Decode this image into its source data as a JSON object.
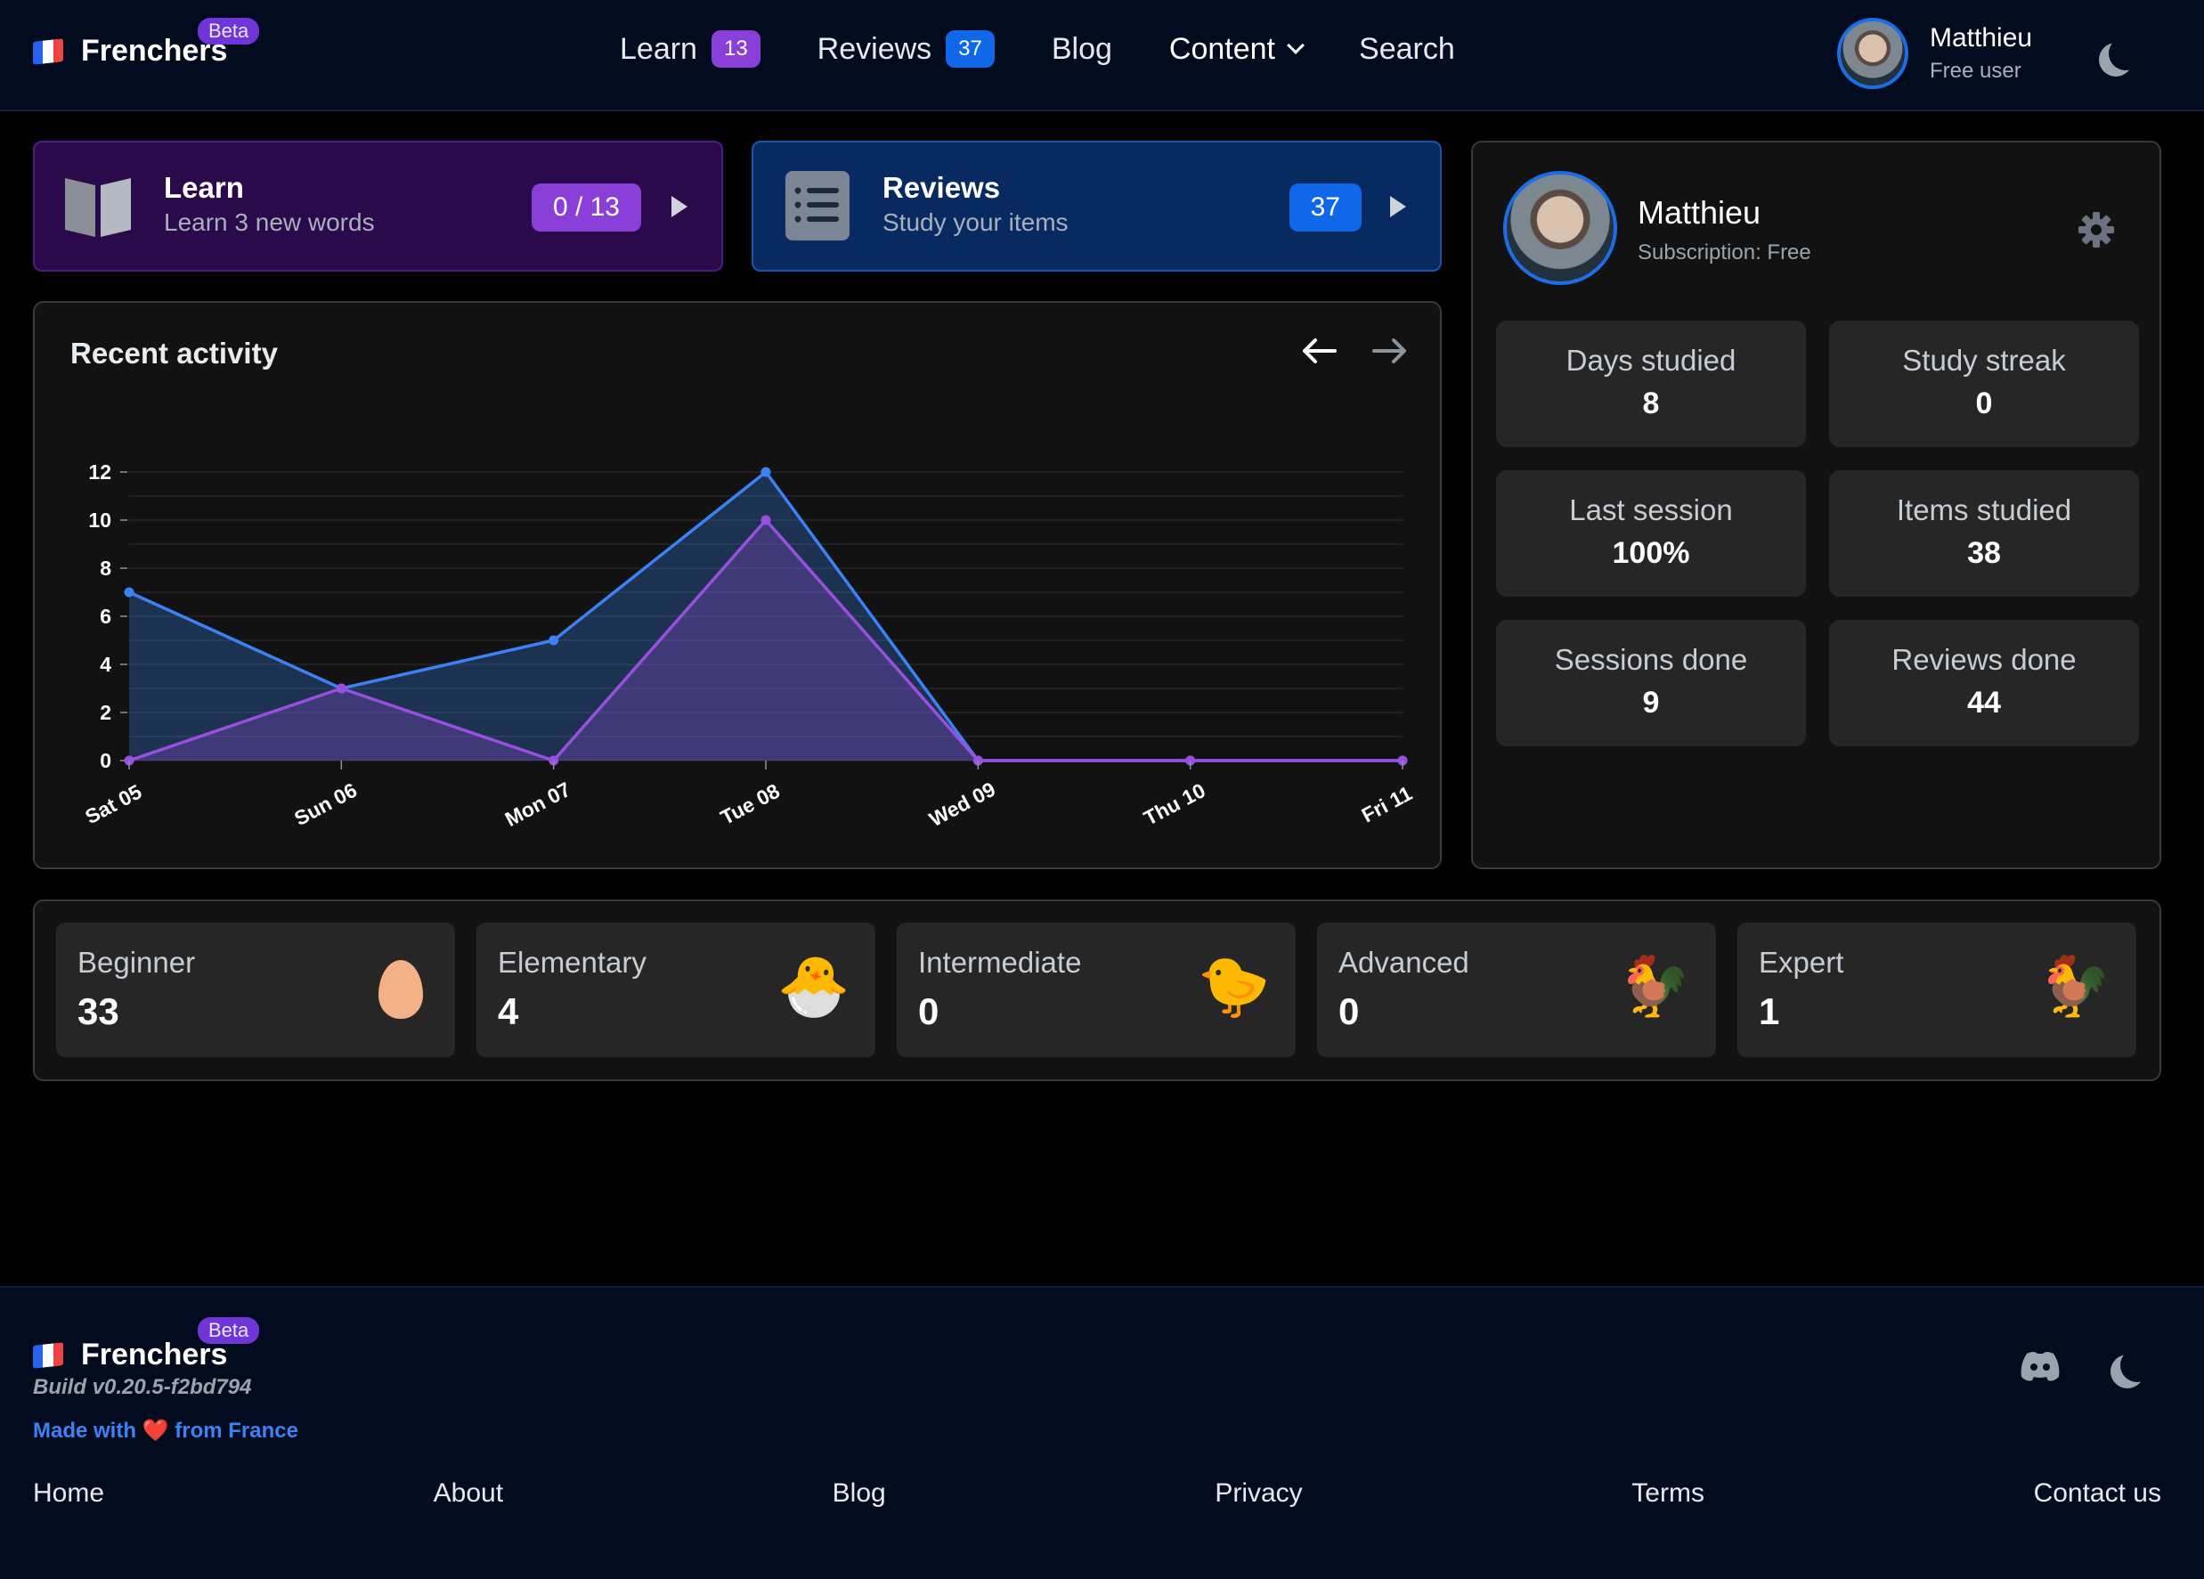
{
  "nav": {
    "brand": "Frenchers",
    "beta": "Beta",
    "learn_label": "Learn",
    "learn_count": "13",
    "reviews_label": "Reviews",
    "reviews_count": "37",
    "blog_label": "Blog",
    "content_label": "Content",
    "search_label": "Search",
    "user_name": "Matthieu",
    "user_plan": "Free user",
    "theme_icon": "moon-icon"
  },
  "cards": {
    "learn": {
      "title": "Learn",
      "subtitle": "Learn 3 new words",
      "progress": "0 / 13",
      "icon": "book-icon"
    },
    "reviews": {
      "title": "Reviews",
      "subtitle": "Study your items",
      "count": "37",
      "icon": "list-icon"
    }
  },
  "activity": {
    "title": "Recent activity",
    "prev_icon": "arrow-left-icon",
    "next_icon": "arrow-right-icon"
  },
  "chart_data": {
    "type": "area",
    "title": "Recent activity",
    "categories": [
      "Sat 05",
      "Sun 06",
      "Mon 07",
      "Tue 08",
      "Wed 09",
      "Thu 10",
      "Fri 11"
    ],
    "series": [
      {
        "values": [
          7,
          3,
          5,
          12,
          0,
          0,
          0
        ],
        "color": "#3b82f6"
      },
      {
        "values": [
          0,
          3,
          0,
          10,
          0,
          0,
          0
        ],
        "color": "#9a4fe0"
      }
    ],
    "ylim": [
      0,
      12
    ],
    "yticks": [
      "0",
      "2",
      "4",
      "6",
      "8",
      "10",
      "12"
    ],
    "grid": true
  },
  "profile": {
    "name": "Matthieu",
    "subscription": "Subscription: Free",
    "settings_icon": "gear-icon",
    "stats": [
      {
        "label": "Days studied",
        "value": "8"
      },
      {
        "label": "Study streak",
        "value": "0"
      },
      {
        "label": "Last session",
        "value": "100%"
      },
      {
        "label": "Items studied",
        "value": "38"
      },
      {
        "label": "Sessions done",
        "value": "9"
      },
      {
        "label": "Reviews done",
        "value": "44"
      }
    ]
  },
  "levels": [
    {
      "label": "Beginner",
      "value": "33",
      "icon": "🥚"
    },
    {
      "label": "Elementary",
      "value": "4",
      "icon": "🐣"
    },
    {
      "label": "Intermediate",
      "value": "0",
      "icon": "🐤"
    },
    {
      "label": "Advanced",
      "value": "0",
      "icon": "🐓"
    },
    {
      "label": "Expert",
      "value": "1",
      "icon": "🐓"
    }
  ],
  "footer": {
    "brand": "Frenchers",
    "beta": "Beta",
    "build": "Build v0.20.5-f2bd794",
    "made_with": "Made with",
    "heart": "❤️",
    "from_france": "from France",
    "links": [
      "Home",
      "About",
      "Blog",
      "Privacy",
      "Terms",
      "Contact us"
    ]
  }
}
